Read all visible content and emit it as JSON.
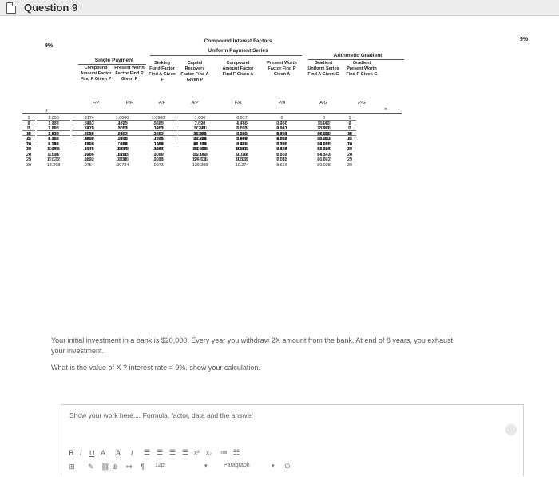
{
  "header": {
    "title": "Question 9"
  },
  "factors": {
    "rate_left": "9%",
    "rate_right": "9%",
    "title_main": "Compound Interest Factors",
    "title_uniform": "Uniform Payment Series",
    "title_single": "Single Payment",
    "title_arith": "Arithmetic Gradient",
    "columns": [
      {
        "head": "n",
        "code": ""
      },
      {
        "head": "Compound Amount Factor Find F Given P",
        "code": "F/P"
      },
      {
        "head": "Present Worth Factor Find P Given F",
        "code": "P/F"
      },
      {
        "head": "Sinking Fund Factor Find A Given F",
        "code": "A/F"
      },
      {
        "head": "Capital Recovery Factor Find A Given P",
        "code": "A/P"
      },
      {
        "head": "Compound Amount Factor Find F Given A",
        "code": "F/A"
      },
      {
        "head": "Present Worth Factor Find P Given A",
        "code": "P/A"
      },
      {
        "head": "Gradient Uniform Series Find A Given G",
        "code": "A/G"
      },
      {
        "head": "Gradient Present Worth Find P Given G",
        "code": "P/G"
      },
      {
        "head": "n",
        "code": ""
      }
    ],
    "n": [
      "1",
      "2",
      "3",
      "4",
      "5",
      "6",
      "7",
      "8",
      "9",
      "10",
      "11",
      "12",
      "13",
      "14",
      "15",
      "16",
      "17",
      "18",
      "19",
      "20",
      "21",
      "22",
      "23",
      "24",
      "25",
      "26",
      "27",
      "28",
      "29",
      "30"
    ],
    "fp": [
      "1.090",
      "1.188",
      "1.295",
      "1.412",
      "1.539",
      "1.677",
      "1.828",
      "1.993",
      "2.172",
      "2.367",
      "2.580",
      "2.813",
      "3.066",
      "3.342",
      "3.642",
      "3.970",
      "4.328",
      "4.717",
      "5.142",
      "5.604",
      "6.109",
      "6.659",
      "7.258",
      "7.911",
      "8.623",
      "9.399",
      "10.245",
      "11.167",
      "12.172",
      "13.268"
    ],
    "pf": [
      ".9174",
      ".8417",
      ".7722",
      ".7084",
      ".6499",
      ".5963",
      ".5470",
      ".5019",
      ".4604",
      ".4224",
      ".3875",
      ".3555",
      ".3262",
      ".2992",
      ".2745",
      ".2519",
      ".2311",
      ".2120",
      ".1945",
      ".1784",
      ".1637",
      ".1502",
      ".1378",
      ".1264",
      ".1160",
      ".1064",
      ".0976",
      ".0895",
      ".0822",
      ".0754"
    ],
    "af": [
      "1.0000",
      ".4785",
      ".3051",
      ".2187",
      ".1671",
      ".1329",
      ".1087",
      ".0907",
      ".0768",
      ".0658",
      ".0569",
      ".0497",
      ".0436",
      ".0384",
      ".0341",
      ".0303",
      ".0270",
      ".0242",
      ".0217",
      ".0195",
      ".0176",
      ".0159",
      ".0144",
      ".0130",
      ".0118",
      ".0107",
      ".00973",
      ".00885",
      ".00806",
      ".00734"
    ],
    "ap": [
      "1.0900",
      ".5685",
      ".3951",
      ".3087",
      ".2571",
      ".2229",
      ".1987",
      ".1807",
      ".1668",
      ".1558",
      ".1469",
      ".1397",
      ".1336",
      ".1284",
      ".1241",
      ".1203",
      ".1170",
      ".1142",
      ".1117",
      ".1095",
      ".1076",
      ".1059",
      ".1044",
      ".1030",
      ".1018",
      ".1007",
      ".0997",
      ".0989",
      ".0981",
      ".0973"
    ],
    "fa": [
      "1.000",
      "2.090",
      "3.278",
      "4.573",
      "5.985",
      "7.523",
      "9.200",
      "11.028",
      "13.021",
      "15.193",
      "17.560",
      "20.141",
      "22.953",
      "26.019",
      "29.361",
      "33.003",
      "36.974",
      "41.301",
      "46.019",
      "51.160",
      "56.765",
      "62.873",
      "69.532",
      "76.790",
      "84.701",
      "93.324",
      "102.723",
      "112.968",
      "124.136",
      "136.308"
    ],
    "pa": [
      "0.917",
      "1.759",
      "2.531",
      "3.240",
      "3.890",
      "4.486",
      "5.033",
      "5.535",
      "5.995",
      "6.418",
      "6.805",
      "7.161",
      "7.487",
      "7.786",
      "8.061",
      "8.313",
      "8.544",
      "8.756",
      "8.950",
      "9.129",
      "9.292",
      "9.442",
      "9.580",
      "9.707",
      "9.823",
      "9.929",
      "10.027",
      "10.116",
      "10.198",
      "10.274"
    ],
    "ag": [
      "0",
      "0.478",
      "0.943",
      "1.393",
      "1.828",
      "2.250",
      "2.657",
      "3.051",
      "3.431",
      "3.798",
      "4.151",
      "4.491",
      "4.818",
      "5.133",
      "5.435",
      "5.724",
      "6.002",
      "6.269",
      "6.524",
      "6.767",
      "7.001",
      "7.223",
      "7.436",
      "7.638",
      "7.832",
      "8.016",
      "8.191",
      "8.357",
      "8.515",
      "8.666"
    ],
    "pg": [
      "0",
      "0.842",
      "2.386",
      "4.511",
      "7.111",
      "10.092",
      "13.375",
      "16.888",
      "20.571",
      "24.373",
      "28.248",
      "32.159",
      "36.073",
      "39.963",
      "43.807",
      "47.585",
      "51.282",
      "54.886",
      "58.387",
      "61.777",
      "65.051",
      "68.205",
      "71.236",
      "74.143",
      "76.927",
      "79.586",
      "82.124",
      "84.542",
      "86.842",
      "89.028"
    ]
  },
  "question": {
    "line1": "Your initial investment in a bank is $20,000. Every year you withdraw 2X amount from the bank. At end of 8 years, you exhaust",
    "line2": "your investment.",
    "line3": "What is the value of X ? interest rate = 9%. show your calculation."
  },
  "answer": {
    "label": "Show your work here.... Formula, factor, data and the answer"
  },
  "editor": {
    "bold": "B",
    "italic": "I",
    "underline": "U",
    "font_color": "A",
    "highlight": "A",
    "clear_format": "I",
    "superscript": "x²",
    "subscript": "x₂",
    "font_size": "12pt",
    "paragraph": "Paragraph"
  }
}
